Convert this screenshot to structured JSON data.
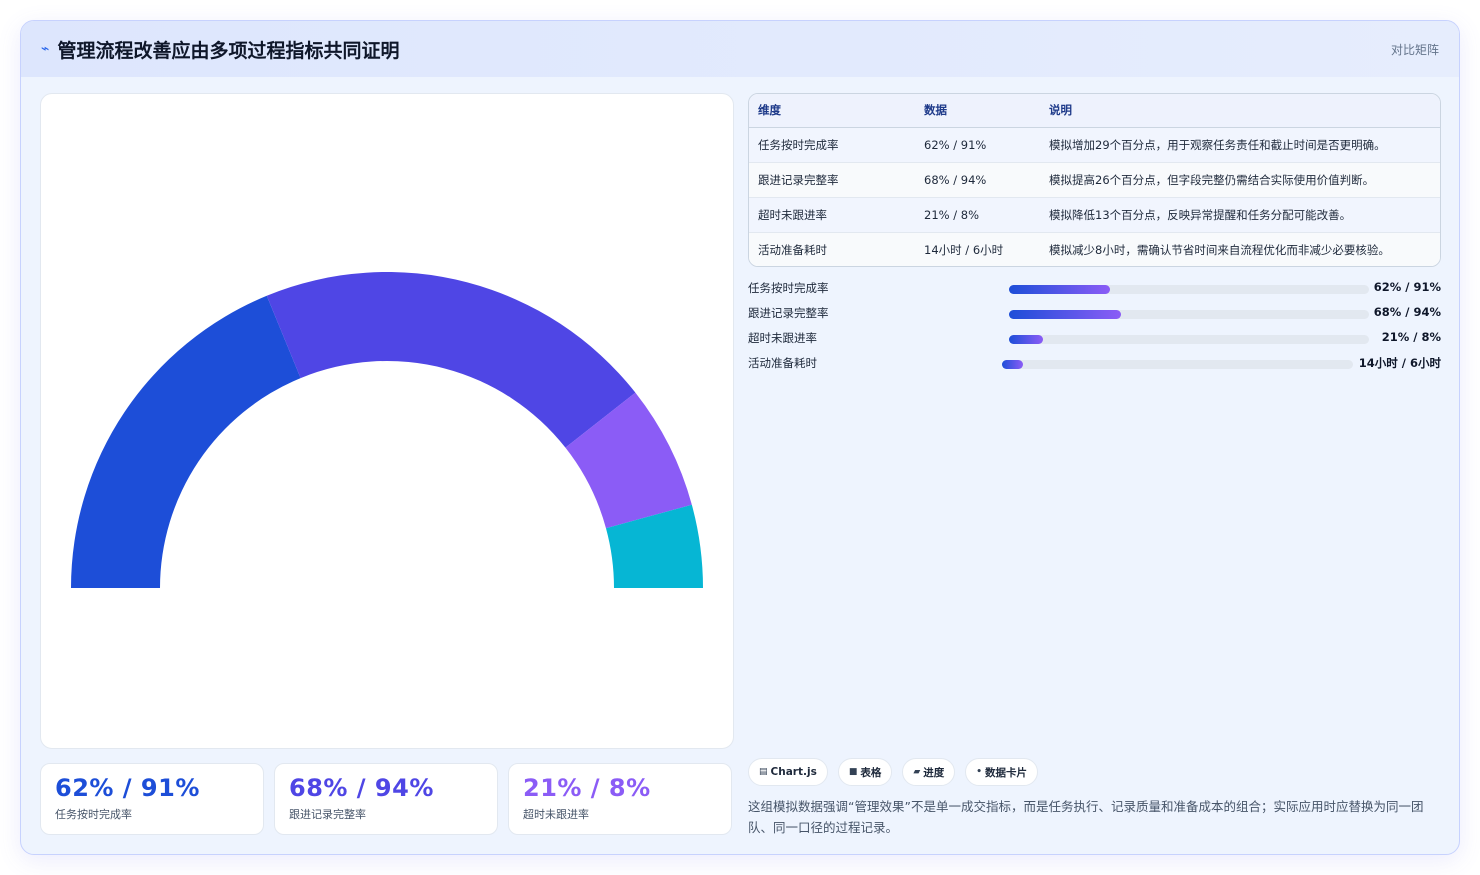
{
  "header": {
    "icon": "trend-line-icon",
    "title": "管理流程改善应由多项过程指标共同证明",
    "tag": "对比矩阵"
  },
  "chart_data": {
    "type": "pie",
    "variant": "half-donut",
    "categories": [
      "任务按时完成率",
      "跟进记录完整率",
      "超时未跟进率",
      "活动准备耗时"
    ],
    "values": [
      62,
      68,
      21,
      14
    ],
    "colors": [
      "#1d4ed8",
      "#4f46e5",
      "#8b5cf6",
      "#06b6d4"
    ]
  },
  "kpis": [
    {
      "value": "62% / 91%",
      "label": "任务按时完成率",
      "color": "#1d4ed8"
    },
    {
      "value": "68% / 94%",
      "label": "跟进记录完整率",
      "color": "#4f46e5"
    },
    {
      "value": "21% / 8%",
      "label": "超时未跟进率",
      "color": "#8b5cf6"
    }
  ],
  "table": {
    "headers": [
      "维度",
      "数据",
      "说明"
    ],
    "rows": [
      [
        "任务按时完成率",
        "62% / 91%",
        "模拟增加29个百分点，用于观察任务责任和截止时间是否更明确。"
      ],
      [
        "跟进记录完整率",
        "68% / 94%",
        "模拟提高26个百分点，但字段完整仍需结合实际使用价值判断。"
      ],
      [
        "超时未跟进率",
        "21% / 8%",
        "模拟降低13个百分点，反映异常提醒和任务分配可能改善。"
      ],
      [
        "活动准备耗时",
        "14小时 / 6小时",
        "模拟减少8小时，需确认节省时间来自流程优化而非减少必要核验。"
      ]
    ]
  },
  "progress": [
    {
      "label": "任务按时完成率",
      "value": "62% / 91%",
      "fill": 0.28
    },
    {
      "label": "跟进记录完整率",
      "value": "68% / 94%",
      "fill": 0.31
    },
    {
      "label": "超时未跟进率",
      "value": "21% / 8%",
      "fill": 0.095
    },
    {
      "label": "活动准备耗时",
      "value": "14小时 / 6小时",
      "fill": 0.06
    }
  ],
  "chips": [
    {
      "icon": "chart-icon",
      "glyph": "▤",
      "label": "Chart.js"
    },
    {
      "icon": "table-icon",
      "glyph": "■",
      "label": "表格"
    },
    {
      "icon": "progress-icon",
      "glyph": "▰",
      "label": "进度"
    },
    {
      "icon": "card-icon",
      "glyph": "•",
      "label": "数据卡片"
    }
  ],
  "note": "这组模拟数据强调“管理效果”不是单一成交指标，而是任务执行、记录质量和准备成本的组合；实际应用时应替换为同一团队、同一口径的过程记录。"
}
